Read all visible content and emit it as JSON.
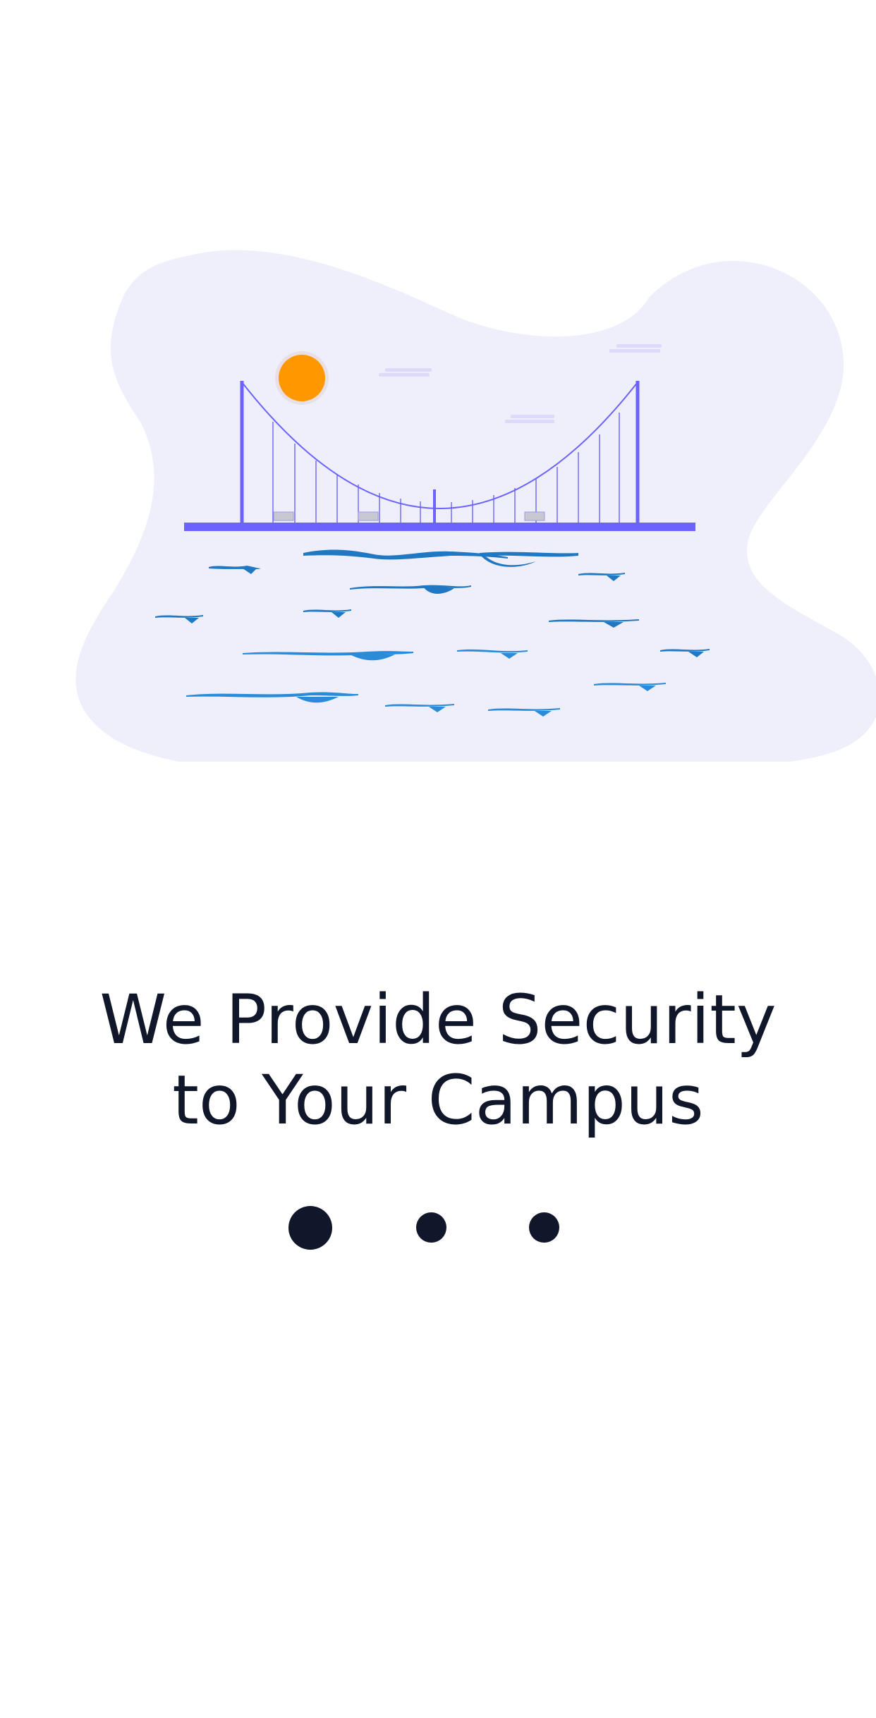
{
  "onboarding": {
    "headline_line1": "We Provide Security",
    "headline_line2": "to Your Campus",
    "current_page": 1,
    "total_pages": 3,
    "pages": [
      {
        "label": "Page 1",
        "active": true
      },
      {
        "label": "Page 2",
        "active": false
      },
      {
        "label": "Page 3",
        "active": false
      }
    ]
  },
  "illustration": {
    "name": "bridge-over-water-illustration",
    "colors": {
      "blob": "#efeffc",
      "bridge": "#6c63ff",
      "sun": "#ff9800",
      "water": "#2a8bd8",
      "clouds": "#ddd9fb",
      "benches": "#c8c8d0"
    }
  },
  "theme": {
    "text_color": "#11172b",
    "background": "#ffffff"
  }
}
